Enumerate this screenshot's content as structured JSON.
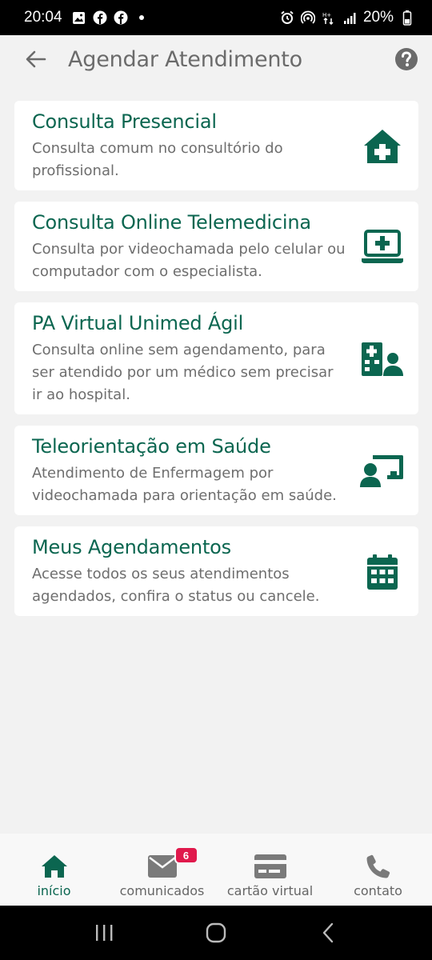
{
  "status_bar": {
    "time": "20:04",
    "battery": "20%",
    "left_icons": [
      "gallery-icon",
      "facebook-icon",
      "facebook-icon",
      "dot-icon"
    ],
    "right_icons": [
      "alarm-icon",
      "hotspot-icon",
      "data-icon",
      "signal-icon",
      "battery-icon"
    ]
  },
  "header": {
    "title": "Agendar Atendimento",
    "back_icon": "arrow-left-icon",
    "help_icon": "help-circle-icon"
  },
  "cards": [
    {
      "title": "Consulta Presencial",
      "description": "Consulta comum no consultório do profissional.",
      "icon": "clinic-house-icon"
    },
    {
      "title": "Consulta Online Telemedicina",
      "description": "Consulta por videochamada pelo celular ou computador com o especialista.",
      "icon": "laptop-medical-icon"
    },
    {
      "title": "PA Virtual Unimed Ágil",
      "description": "Consulta online sem agendamento, para ser atendido por um médico sem precisar ir ao hospital.",
      "icon": "hospital-user-icon"
    },
    {
      "title": "Teleorientação em Saúde",
      "description": "Atendimento de Enfermagem por videochamada para orientação em saúde.",
      "icon": "chalkboard-user-icon"
    },
    {
      "title": "Meus Agendamentos",
      "description": "Acesse todos os seus atendimentos agendados, confira o status ou cancele.",
      "icon": "calendar-icon"
    }
  ],
  "bottom_nav": {
    "items": [
      {
        "label": "início",
        "icon": "home-icon",
        "active": true
      },
      {
        "label": "comunicados",
        "icon": "envelope-icon",
        "badge": "6"
      },
      {
        "label": "cartão virtual",
        "icon": "card-icon"
      },
      {
        "label": "contato",
        "icon": "phone-icon"
      }
    ]
  },
  "colors": {
    "primary": "#0b6650",
    "badge": "#e0194c",
    "background": "#f2f2f2",
    "title_gray": "#6b6b6b",
    "icon_gray": "#7a7a7a"
  }
}
